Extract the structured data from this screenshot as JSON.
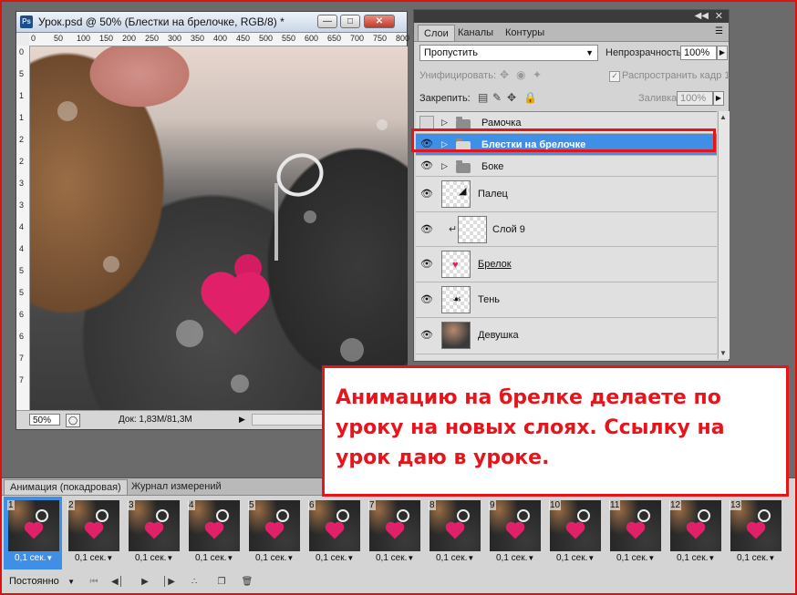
{
  "document": {
    "title": "Урок.psd @ 50% (Блестки на брелочке, RGB/8) *",
    "app_badge": "Ps",
    "ruler_top_ticks": [
      "0",
      "50",
      "100",
      "150",
      "200",
      "250",
      "300",
      "350",
      "400",
      "450",
      "500",
      "550",
      "600",
      "650",
      "700",
      "750",
      "800"
    ],
    "ruler_left_ticks": [
      "0",
      "5",
      "1",
      "1",
      "2",
      "2",
      "3",
      "3",
      "4",
      "4",
      "5",
      "5",
      "6",
      "6",
      "7",
      "7"
    ],
    "status": {
      "zoom": "50%",
      "doc_info": "Док: 1,83M/81,3M"
    },
    "window_buttons": [
      "minimize",
      "restore",
      "close"
    ]
  },
  "layers_panel": {
    "tabs": [
      "Слои",
      "Каналы",
      "Контуры"
    ],
    "active_tab": "Слои",
    "blend_mode": "Пропустить",
    "opacity_label": "Непрозрачность:",
    "opacity_value": "100%",
    "unify_label": "Унифицировать:",
    "propagate_label": "Распространить кадр 1",
    "lock_label": "Закрепить:",
    "fill_label": "Заливка:",
    "fill_value": "100%",
    "layers": [
      {
        "name": "Рамочка",
        "type": "group",
        "visible": false,
        "selected": false
      },
      {
        "name": "Блестки на брелочке",
        "type": "group",
        "visible": true,
        "selected": true
      },
      {
        "name": "Боке",
        "type": "group",
        "visible": true,
        "selected": false
      },
      {
        "name": "Палец",
        "type": "layer",
        "visible": true,
        "selected": false
      },
      {
        "name": "Слой 9",
        "type": "clipped-layer",
        "visible": true,
        "selected": false
      },
      {
        "name": "Брелок",
        "type": "layer",
        "visible": true,
        "selected": false
      },
      {
        "name": "Тень",
        "type": "layer",
        "visible": true,
        "selected": false
      },
      {
        "name": "Девушка",
        "type": "layer",
        "visible": true,
        "selected": false
      }
    ]
  },
  "callout": {
    "text": "Анимацию на брелке делаете по уроку на новых слоях. Ссылку на урок даю в уроке."
  },
  "animation_panel": {
    "tabs": [
      "Анимация (покадровая)",
      "Журнал измерений"
    ],
    "active_tab": "Анимация (покадровая)",
    "frames": [
      {
        "number": "1",
        "delay": "0,1 сек."
      },
      {
        "number": "2",
        "delay": "0,1 сек."
      },
      {
        "number": "3",
        "delay": "0,1 сек."
      },
      {
        "number": "4",
        "delay": "0,1 сек."
      },
      {
        "number": "5",
        "delay": "0,1 сек."
      },
      {
        "number": "6",
        "delay": "0,1 сек."
      },
      {
        "number": "7",
        "delay": "0,1 сек."
      },
      {
        "number": "8",
        "delay": "0,1 сек."
      },
      {
        "number": "9",
        "delay": "0,1 сек."
      },
      {
        "number": "10",
        "delay": "0,1 сек."
      },
      {
        "number": "11",
        "delay": "0,1 сек."
      },
      {
        "number": "12",
        "delay": "0,1 сек."
      },
      {
        "number": "13",
        "delay": "0,1 сек."
      }
    ],
    "selected_frame": "1",
    "loop_option": "Постоянно"
  },
  "colors": {
    "highlight_red": "#e8141b",
    "selection_blue": "#3f8fe6",
    "charm_pink": "#e0216a"
  }
}
